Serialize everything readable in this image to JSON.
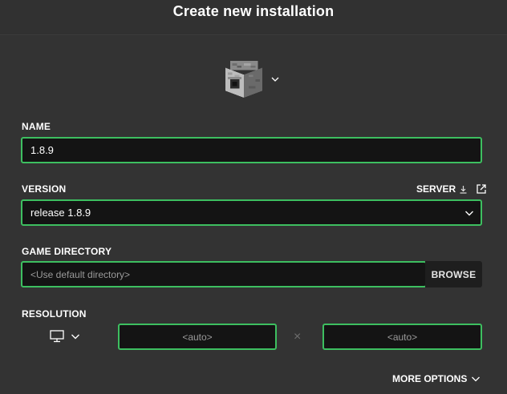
{
  "dialog": {
    "title": "Create new installation"
  },
  "icon_selector": {
    "icon": "furnace-icon"
  },
  "name": {
    "label": "NAME",
    "value": "1.8.9"
  },
  "version": {
    "label": "VERSION",
    "selected": "release 1.8.9",
    "server_link": "SERVER"
  },
  "game_directory": {
    "label": "GAME DIRECTORY",
    "placeholder": "<Use default directory>",
    "browse_label": "BROWSE"
  },
  "resolution": {
    "label": "RESOLUTION",
    "width_placeholder": "<auto>",
    "height_placeholder": "<auto>",
    "separator": "×"
  },
  "more_options": {
    "label": "MORE OPTIONS"
  },
  "colors": {
    "background": "#333333",
    "field_background": "#141414",
    "accent_border": "#3dbf60"
  }
}
